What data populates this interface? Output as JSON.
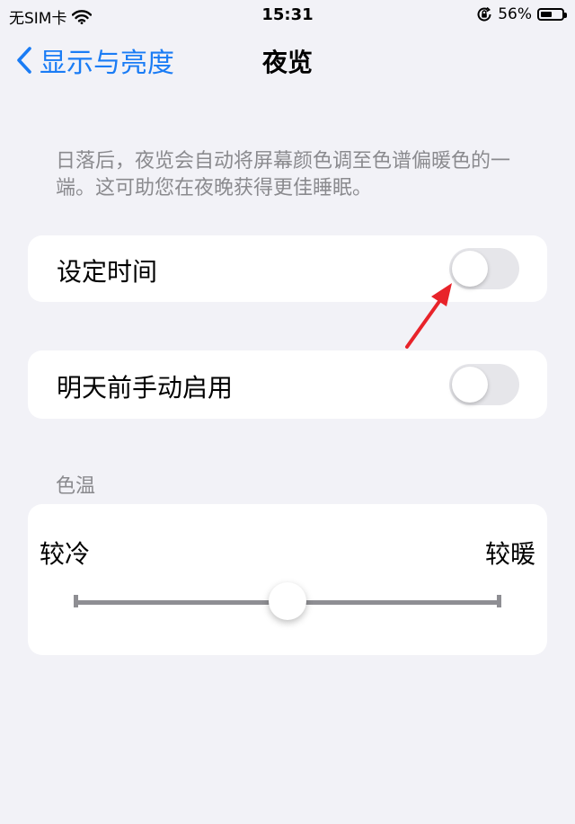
{
  "status_bar": {
    "carrier": "无SIM卡",
    "time": "15:31",
    "battery_text": "56%",
    "battery_level": 0.56,
    "icons": [
      "wifi-icon",
      "orientation-lock-icon",
      "battery-icon"
    ]
  },
  "nav": {
    "back_label": "显示与亮度",
    "title": "夜览"
  },
  "description": "日落后，夜览会自动将屏幕颜色调至色谱偏暖色的一端。这可助您在夜晚获得更佳睡眠。",
  "schedule": {
    "label": "设定时间",
    "enabled": false
  },
  "manual": {
    "label": "明天前手动启用",
    "enabled": false
  },
  "color_temp": {
    "section_label": "色温",
    "min_label": "较冷",
    "max_label": "较暖",
    "value": 0.5
  },
  "colors": {
    "accent": "#1a7cf5",
    "annotation": "#e8232a"
  }
}
